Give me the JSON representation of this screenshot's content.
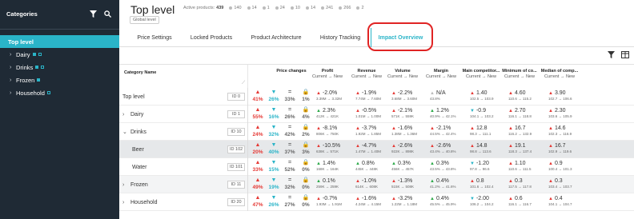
{
  "sidebar": {
    "title": "Categories",
    "items": [
      {
        "label": "Top level",
        "indent": 0,
        "chevron": "",
        "active": true,
        "squares": []
      },
      {
        "label": "Dairy",
        "indent": 1,
        "chevron": "›",
        "active": false,
        "squares": [
          "filled",
          "outline"
        ]
      },
      {
        "label": "Drinks",
        "indent": 1,
        "chevron": "›",
        "active": false,
        "squares": [
          "filled",
          "outline"
        ]
      },
      {
        "label": "Frozen",
        "indent": 1,
        "chevron": "›",
        "active": false,
        "squares": [
          "filled"
        ]
      },
      {
        "label": "Household",
        "indent": 1,
        "chevron": "›",
        "active": false,
        "squares": [
          "outline"
        ]
      }
    ]
  },
  "header": {
    "title": "Top level",
    "badge": "Global level",
    "active_products_label": "Active products:",
    "active_products_value": "439",
    "stats": [
      "140",
      "14",
      "1",
      "24",
      "10",
      "14",
      "241",
      "266",
      "2"
    ]
  },
  "tabs": [
    {
      "label": "Price Settings",
      "active": false
    },
    {
      "label": "Locked Products",
      "active": false
    },
    {
      "label": "Product Architecture",
      "active": false
    },
    {
      "label": "History Tracking",
      "active": false
    },
    {
      "label": "Impact Overview",
      "active": true
    }
  ],
  "table": {
    "category_header": "Category Name",
    "price_changes_header": "Price changes",
    "metric_headers": [
      {
        "title": "Profit",
        "sub": "Current → New"
      },
      {
        "title": "Revenue",
        "sub": "Current → New"
      },
      {
        "title": "Volume",
        "sub": "Current → New"
      },
      {
        "title": "Margin",
        "sub": "Current → New"
      },
      {
        "title": "Main competitor...",
        "sub": "Current → New"
      },
      {
        "title": "Minimum of co...",
        "sub": "Current → New"
      },
      {
        "title": "Median of comp...",
        "sub": "Current → New"
      }
    ],
    "rows": [
      {
        "name": "Top level",
        "chevron": "",
        "child": false,
        "id": "ID 0",
        "style": "",
        "pc": [
          "41%",
          "26%",
          "33%",
          "1%"
        ],
        "m": [
          [
            "up",
            "-2.0%",
            "3.39M → 3.32M"
          ],
          [
            "up",
            "-1.9%",
            "7.74M → 7.60M"
          ],
          [
            "up",
            "-2.2%",
            "3.68M → 3.60M"
          ],
          [
            "na",
            "N/A",
            "43.8%"
          ],
          [
            "up",
            "1.40",
            "102.5 → 103.9"
          ],
          [
            "up",
            "4.60",
            "110.6 → 115.2"
          ],
          [
            "up",
            "3.90",
            "102.7 → 106.6"
          ]
        ]
      },
      {
        "name": "Dairy",
        "chevron": "›",
        "child": false,
        "id": "ID 1",
        "style": "",
        "pc": [
          "55%",
          "16%",
          "26%",
          "4%"
        ],
        "m": [
          [
            "gr",
            "2.3%",
            "412K → 421K"
          ],
          [
            "up",
            "-0.5%",
            "1.01M → 1.00M"
          ],
          [
            "up",
            "-2.1%",
            "571K → 559K"
          ],
          [
            "gr",
            "1.2%",
            "40.9% → 42.1%"
          ],
          [
            "dn",
            "-0.9",
            "104.1 → 103.2"
          ],
          [
            "up",
            "2.70",
            "116.1 → 118.8"
          ],
          [
            "up",
            "2.30",
            "103.6 → 105.9"
          ]
        ]
      },
      {
        "name": "Drinks",
        "chevron": "⌄",
        "child": false,
        "id": "ID 10",
        "style": "",
        "pc": [
          "24%",
          "32%",
          "42%",
          "2%"
        ],
        "m": [
          [
            "up",
            "-8.1%",
            "806K → 750K"
          ],
          [
            "up",
            "-3.7%",
            "1.92M → 1.85M"
          ],
          [
            "up",
            "-1.6%",
            "1.38M → 1.36M"
          ],
          [
            "up",
            "-2.1%",
            "44.5% → 42.4%"
          ],
          [
            "up",
            "12.8",
            "98.3 → 111.1"
          ],
          [
            "up",
            "16.7",
            "116.2 → 132.9"
          ],
          [
            "up",
            "14.6",
            "102.3 → 116.9"
          ]
        ]
      },
      {
        "name": "Beer",
        "chevron": "",
        "child": true,
        "id": "ID 102",
        "style": "sel",
        "pc": [
          "20%",
          "40%",
          "37%",
          "3%"
        ],
        "m": [
          [
            "up",
            "-10.5%",
            "638K → 571K"
          ],
          [
            "up",
            "-4.7%",
            "1.47M → 1.40M"
          ],
          [
            "up",
            "-2.6%",
            "922K → 898K"
          ],
          [
            "up",
            "-2.6%",
            "43.4% → 40.8%"
          ],
          [
            "up",
            "14.8",
            "98.8 → 113.6"
          ],
          [
            "up",
            "19.1",
            "118.3 → 137.4"
          ],
          [
            "up",
            "16.7",
            "102.9 → 119.6"
          ]
        ]
      },
      {
        "name": "Water",
        "chevron": "",
        "child": true,
        "id": "ID 101",
        "style": "",
        "pc": [
          "33%",
          "15%",
          "52%",
          "0%"
        ],
        "m": [
          [
            "gr",
            "1.4%",
            "168K → 164K"
          ],
          [
            "gr",
            "0.8%",
            "445K → 448K"
          ],
          [
            "gr",
            "0.3%",
            "456K → 457K"
          ],
          [
            "gr",
            "0.3%",
            "43.5% → 43.8%"
          ],
          [
            "dn",
            "-1.20",
            "97.8 → 96.6"
          ],
          [
            "up",
            "1.10",
            "110.6 → 111.5"
          ],
          [
            "up",
            "0.9",
            "100.4 → 101.3"
          ]
        ]
      },
      {
        "name": "Frozen",
        "chevron": "›",
        "child": false,
        "id": "ID 11",
        "style": "alt",
        "pc": [
          "49%",
          "19%",
          "32%",
          "0%"
        ],
        "m": [
          [
            "gr",
            "0.1%",
            "259K → 259K"
          ],
          [
            "up",
            "-1.0%",
            "614K → 608K"
          ],
          [
            "up",
            "-1.3%",
            "515K → 508K"
          ],
          [
            "gr",
            "0.4%",
            "41.2% → 41.6%"
          ],
          [
            "up",
            "0.8",
            "101.6 → 102.4"
          ],
          [
            "up",
            "0.3",
            "117.5 → 117.8"
          ],
          [
            "up",
            "0.3",
            "103.4 → 103.7"
          ]
        ]
      },
      {
        "name": "Household",
        "chevron": "›",
        "child": false,
        "id": "ID 20",
        "style": "",
        "pc": [
          "47%",
          "26%",
          "27%",
          "0%"
        ],
        "m": [
          [
            "up",
            "-0.7%",
            "1.93M → 1.91M"
          ],
          [
            "up",
            "-1.6%",
            "4.24M → 4.15M"
          ],
          [
            "up",
            "-3.2%",
            "1.22M → 1.18M"
          ],
          [
            "gr",
            "0.4%",
            "45.5% → 45.9%"
          ],
          [
            "dn",
            "-2.00",
            "106.2 → 104.2"
          ],
          [
            "up",
            "0.6",
            "116.1 → 116.7"
          ],
          [
            "up",
            "0.4",
            "104.1 → 104.7"
          ]
        ]
      }
    ]
  },
  "colors": {
    "accent": "#2ab4c8",
    "up": "#e53935",
    "positive": "#2eaa4a",
    "sidebar": "#1f2a35",
    "highlight": "#e02424"
  }
}
